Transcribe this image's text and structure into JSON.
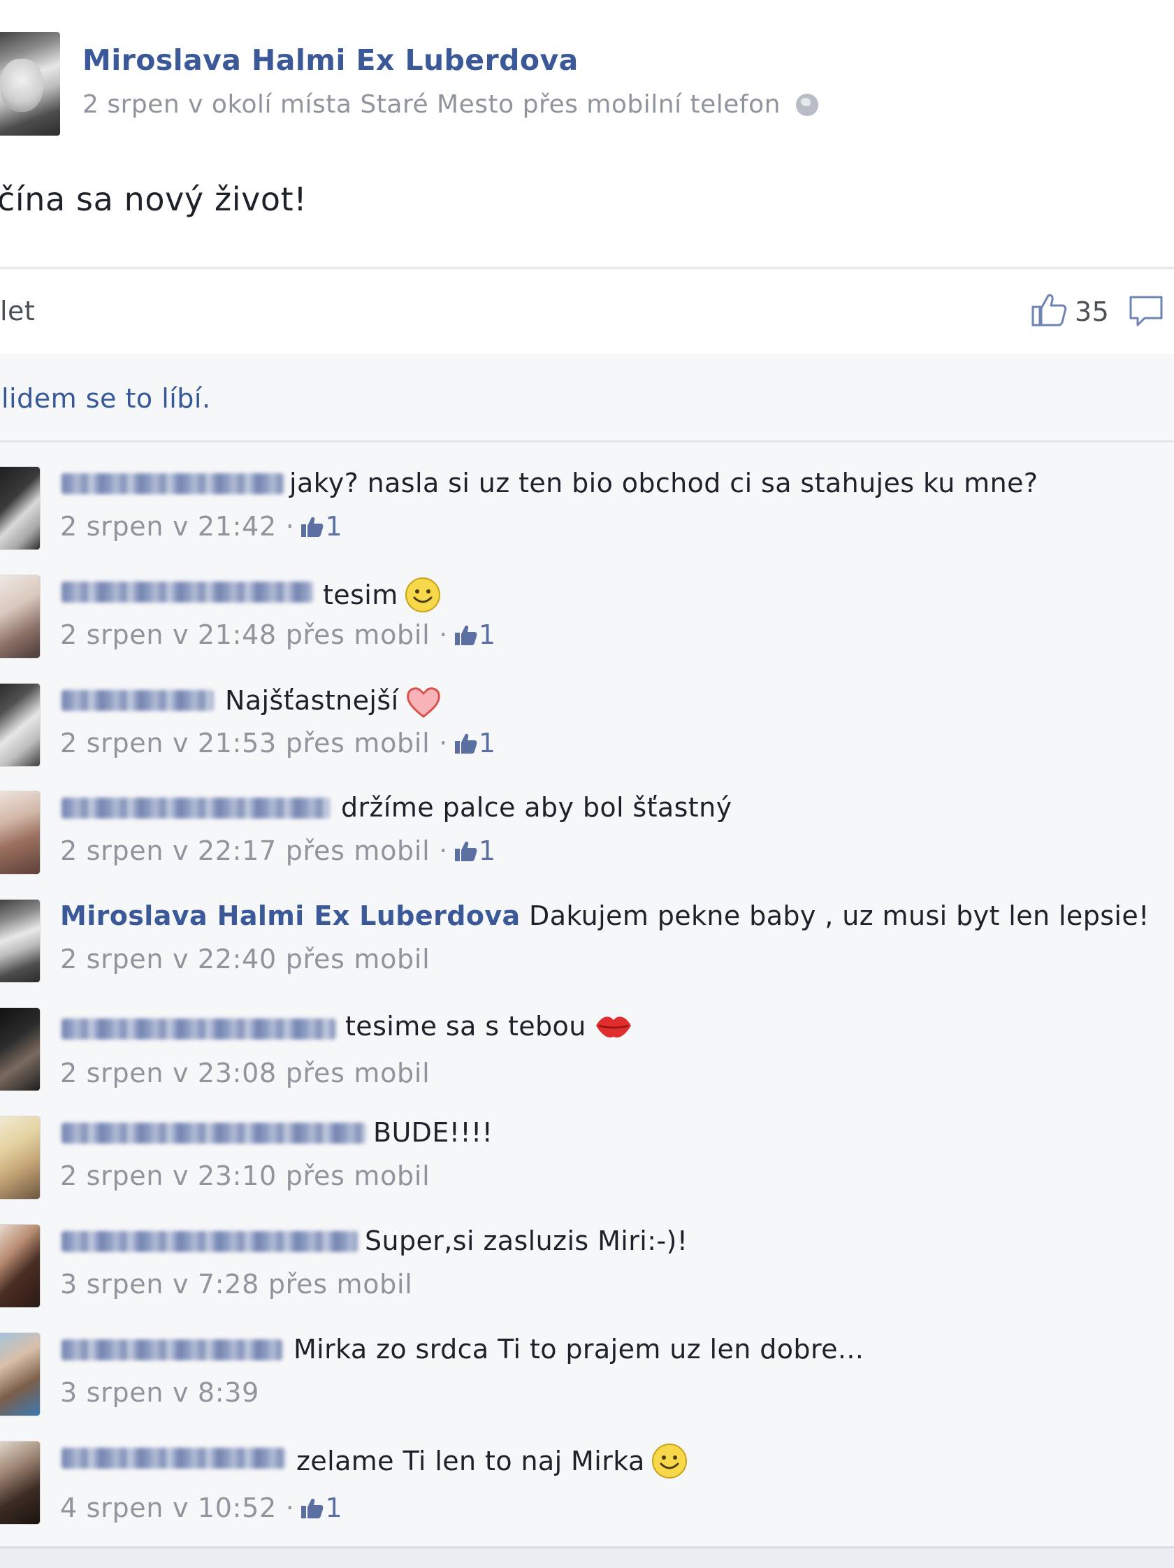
{
  "post": {
    "author": "Miroslava Halmi Ex Luberdova",
    "meta": "2 srpen v okolí místa Staré Mesto přes mobilní telefon",
    "text": "čína sa nový život!"
  },
  "actions": {
    "left_label": "let",
    "like_count": "35"
  },
  "likes_summary": "lidem se to líbí.",
  "comments": [
    {
      "text": "jaky? nasla si uz ten bio obchod ci sa stahujes ku mne?",
      "meta": "2 srpen v 21:42 ·",
      "likes": "1",
      "emoji": ""
    },
    {
      "text": "tesim",
      "meta": "2 srpen v 21:48 přes mobil ·",
      "likes": "1",
      "emoji": "smile"
    },
    {
      "text": "Najšťastnejší",
      "meta": "2 srpen v 21:53 přes mobil ·",
      "likes": "1",
      "emoji": "heart"
    },
    {
      "text": "držíme palce aby bol šťastný",
      "meta": "2 srpen v 22:17 přes mobil ·",
      "likes": "1",
      "emoji": ""
    },
    {
      "author": "Miroslava Halmi Ex Luberdova",
      "text": "Dakujem pekne baby , uz musi byt len lepsie!",
      "meta": "2 srpen v 22:40 přes mobil",
      "emoji": ""
    },
    {
      "text": "tesime sa s tebou",
      "meta": "2 srpen v 23:08 přes mobil",
      "emoji": "kiss"
    },
    {
      "text": "BUDE!!!!",
      "meta": "2 srpen v 23:10 přes mobil",
      "emoji": ""
    },
    {
      "text": "Super,si zasluzis Miri:-)!",
      "meta": "3 srpen v 7:28 přes mobil",
      "emoji": ""
    },
    {
      "text": "Mirka zo srdca Ti to prajem uz len dobre...",
      "meta": "3 srpen v 8:39",
      "emoji": ""
    },
    {
      "text": "zelame Ti len to naj Mirka",
      "meta": "4 srpen v 10:52 ·",
      "likes": "1",
      "emoji": "smile"
    }
  ],
  "colors": {
    "link_blue": "#3b5998",
    "meta_gray": "#90949c",
    "background": "#f6f7f9"
  },
  "icons": [
    "globe-icon",
    "like-icon",
    "comment-icon",
    "smile-emoji",
    "heart-emoji",
    "kiss-emoji"
  ]
}
